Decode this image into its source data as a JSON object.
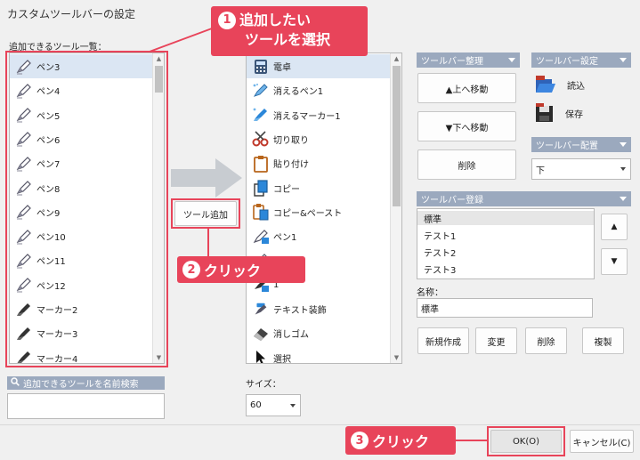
{
  "window": {
    "title": "カスタムツールバーの設定"
  },
  "available": {
    "label": "追加できるツール一覧：",
    "items": [
      "ペン3",
      "ペン4",
      "ペン5",
      "ペン6",
      "ペン7",
      "ペン8",
      "ペン9",
      "ペン10",
      "ペン11",
      "ペン12",
      "マーカー2",
      "マーカー3",
      "マーカー4"
    ],
    "search_placeholder": "追加できるツールを名前検索"
  },
  "add_button": {
    "label": "ツール追加"
  },
  "toolbar_list": {
    "items": [
      "電卓",
      "消えるペン1",
      "消えるマーカー1",
      "切り取り",
      "貼り付け",
      "コピー",
      "コピー&ペースト",
      "ペン1",
      "",
      "1",
      "テキスト装飾",
      "消しゴム",
      "選択"
    ]
  },
  "size": {
    "label": "サイズ：",
    "value": "60"
  },
  "arrange": {
    "header": "ツールバー整理",
    "up": "▲上へ移動",
    "down": "▼下へ移動",
    "delete": "削除"
  },
  "settings": {
    "header": "ツールバー設定",
    "load": "読込",
    "save": "保存"
  },
  "placement": {
    "header": "ツールバー配置",
    "value": "下"
  },
  "register": {
    "header": "ツールバー登録",
    "items": [
      "標準",
      "テスト1",
      "テスト2",
      "テスト3"
    ],
    "up": "▲",
    "down": "▼",
    "name_label": "名称：",
    "name_value": "標準",
    "new": "新規作成",
    "change": "変更",
    "delete": "削除",
    "copy": "複製"
  },
  "footer": {
    "ok": "OK(O)",
    "cancel": "キャンセル(C)"
  },
  "annotations": {
    "step1_num": "1",
    "step1_line1": "追加したい",
    "step1_line2": "ツールを選択",
    "step2_num": "2",
    "step2_text": "クリック",
    "step3_num": "3",
    "step3_text": "クリック"
  },
  "colors": {
    "accent": "#e8445a",
    "header": "#9ba9be",
    "selected": "#dbe6f3"
  }
}
